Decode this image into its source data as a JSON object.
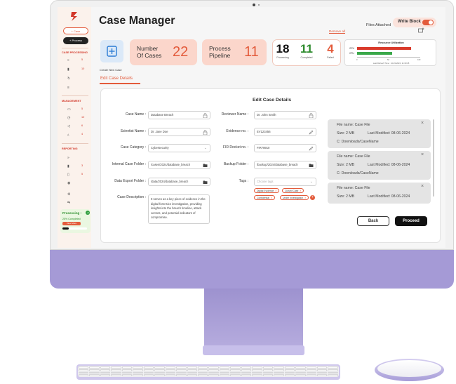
{
  "app": {
    "title": "Case Manager",
    "write_block_label": "Write Block",
    "write_block_on": true
  },
  "sidebar": {
    "new_case_label": "+ Case",
    "new_process_label": "+ Process",
    "sections": {
      "case_processing": "CASE PROCESSING",
      "management": "MANAGEMENT",
      "reporting": "REPORTING"
    },
    "case_processing_items": [
      {
        "icon": "chevrons-icon",
        "count": "5"
      },
      {
        "icon": "file-icon",
        "count": "10"
      },
      {
        "icon": "refresh-icon",
        "count": ""
      },
      {
        "icon": "database-icon",
        "count": ""
      }
    ],
    "management_items": [
      {
        "icon": "folder-icon",
        "count": "5"
      },
      {
        "icon": "clock-icon",
        "count": "10"
      },
      {
        "icon": "megaphone-icon",
        "count": "6"
      },
      {
        "icon": "thumb-icon",
        "count": "4"
      }
    ],
    "reporting_items": [
      {
        "icon": "chevrons-icon",
        "count": ""
      },
      {
        "icon": "bookmark-icon",
        "count": "3"
      },
      {
        "icon": "report-icon",
        "count": "5"
      },
      {
        "icon": "eye-icon",
        "count": ""
      }
    ],
    "bottom_items": [
      {
        "icon": "gear-icon"
      },
      {
        "icon": "arrows-icon"
      }
    ],
    "processing": {
      "title": "Processing :",
      "badge": "+6",
      "percent_text": "25% Completed",
      "button_label": "View More",
      "progress": 0.25
    }
  },
  "summary": {
    "create_label": "Create New Case",
    "cases_label_1": "Number",
    "cases_label_2": "Of Cases",
    "cases_value": "22",
    "pipeline_label_1": "Process",
    "pipeline_label_2": "Pipeline",
    "pipeline_value": "11",
    "processing_value": "18",
    "processing_label": "Processing",
    "completed_value": "11",
    "completed_label": "Completed",
    "failed_value": "4",
    "failed_label": "Failed",
    "colors": {
      "processing": "#111111",
      "completed": "#2e8b2e",
      "failed": "#e35b3b"
    }
  },
  "resource": {
    "title": "Resource Utilization",
    "labels": [
      "GPU",
      "CPU"
    ],
    "values": [
      85,
      55
    ],
    "colors": [
      "#d93a2b",
      "#3aa84a"
    ],
    "ticks": [
      "0",
      "50",
      "100"
    ],
    "refresh": "Last Refresh Time : 14-03-2024, 11:30:45"
  },
  "tab": {
    "label": "Edit Case Details"
  },
  "form": {
    "title": "Edit Case Details",
    "case_name_label": "Case Name :",
    "case_name": "Database Breach",
    "scientist_label": "Scientist Name :",
    "scientist": "Dr. Jane Doe",
    "category_label": "Case Category :",
    "category": "Cybersecurity",
    "internal_folder_label": "Internal Case Folder :",
    "internal_folder": "/cases/2024/database_breach",
    "export_folder_label": "Data Export Folder :",
    "export_folder": "/data/2024/database_breach",
    "description_label": "Case Description :",
    "description": "It serves as a key piece of evidence in the digital forensics investigation, providing insights into the breach timeline, attack vectors, and potential indicators of compromise.",
    "reviewer_label": "Reviewer Name :",
    "reviewer": "Dr. John Smith",
    "evidence_label": "Evidence no. :",
    "evidence": "EV123456",
    "fir_label": "FIR Docket no. :",
    "fir": "FIR78910",
    "backup_label": "Backup Folder :",
    "backup": "/backup/2024/database_breach",
    "tags_label": "Tags :",
    "tags_placeholder": "Choose tags",
    "tags": [
      "Digital Evidence",
      "Closed Case",
      "Confidential",
      "Under Investigation"
    ]
  },
  "files": {
    "title": "Files Attached",
    "remove_all": "Remove all",
    "items": [
      {
        "name": "File name: Case File",
        "size": "Size: 2 MB",
        "modified": "Last Modified: 08-06-2024",
        "path": "C: Downloads/CaseName"
      },
      {
        "name": "File name: Case File",
        "size": "Size: 2 MB",
        "modified": "Last Modified: 08-06-2024",
        "path": "C: Downloads/CaseName"
      },
      {
        "name": "File name: Case File",
        "size": "Size: 2 MB",
        "modified": "Last Modified: 08-06-2024",
        "path": ""
      }
    ]
  },
  "actions": {
    "back": "Back",
    "proceed": "Proceed"
  }
}
